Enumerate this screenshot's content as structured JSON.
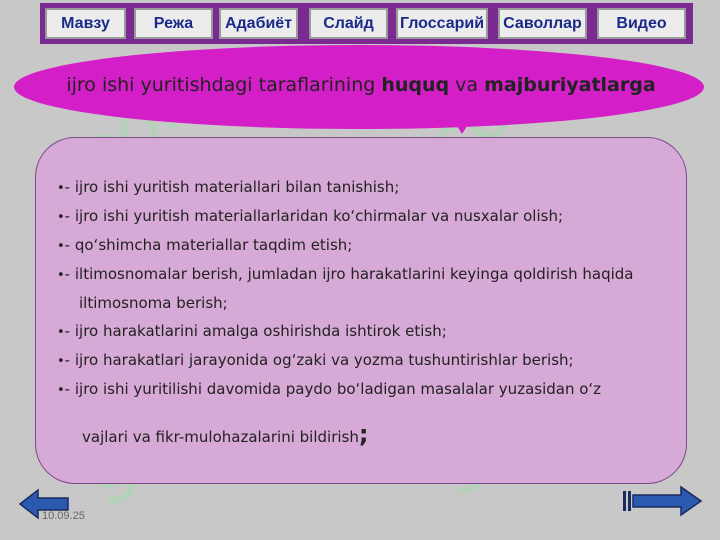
{
  "nav": {
    "items": [
      {
        "label": "Мавзу"
      },
      {
        "label": "Режа"
      },
      {
        "label": "Адабиёт"
      },
      {
        "label": "Слайд"
      },
      {
        "label": "Глоссарий"
      },
      {
        "label": "Саволлар"
      },
      {
        "label": "Видео"
      }
    ]
  },
  "title": {
    "prefix": "ijro ishi yuritishdagi taraflarining ",
    "bold1": "huquq",
    "middle": " va ",
    "bold2": "majburiyatlarga"
  },
  "content": {
    "bullet": "•",
    "lines": [
      "- ijro ishi yuritish materiallari bilan tanishish;",
      "- ijro ishi yuritish materiallarlaridan ko‘chirmalar va nusxalar olish;",
      "- qo‘shimcha materiallar taqdim etish;",
      "- iltimosnomalar berish, jumladan ijro harakatlarini keyinga qoldirish haqida",
      "iltimosnoma berish;",
      "- ijro harakatlarini amalga oshirishda ishtirok etish;",
      "- ijro harakatlari jarayonida og‘zaki va yozma tushuntirishlar berish;",
      "- ijro ishi yuritilishi davomida paydo bo‘ladigan masalalar yuzasidan o‘z",
      "vajlari va fikr-mulohazalarini bildirish",
      ";"
    ]
  },
  "footer": {
    "date": "10.09.25"
  },
  "watermark": "SOF",
  "colors": {
    "nav_bg": "#7b2a92",
    "title_bg": "#d41ec7",
    "content_bg": "#d6a9d6",
    "arrow_blue": "#2a5ab0"
  }
}
